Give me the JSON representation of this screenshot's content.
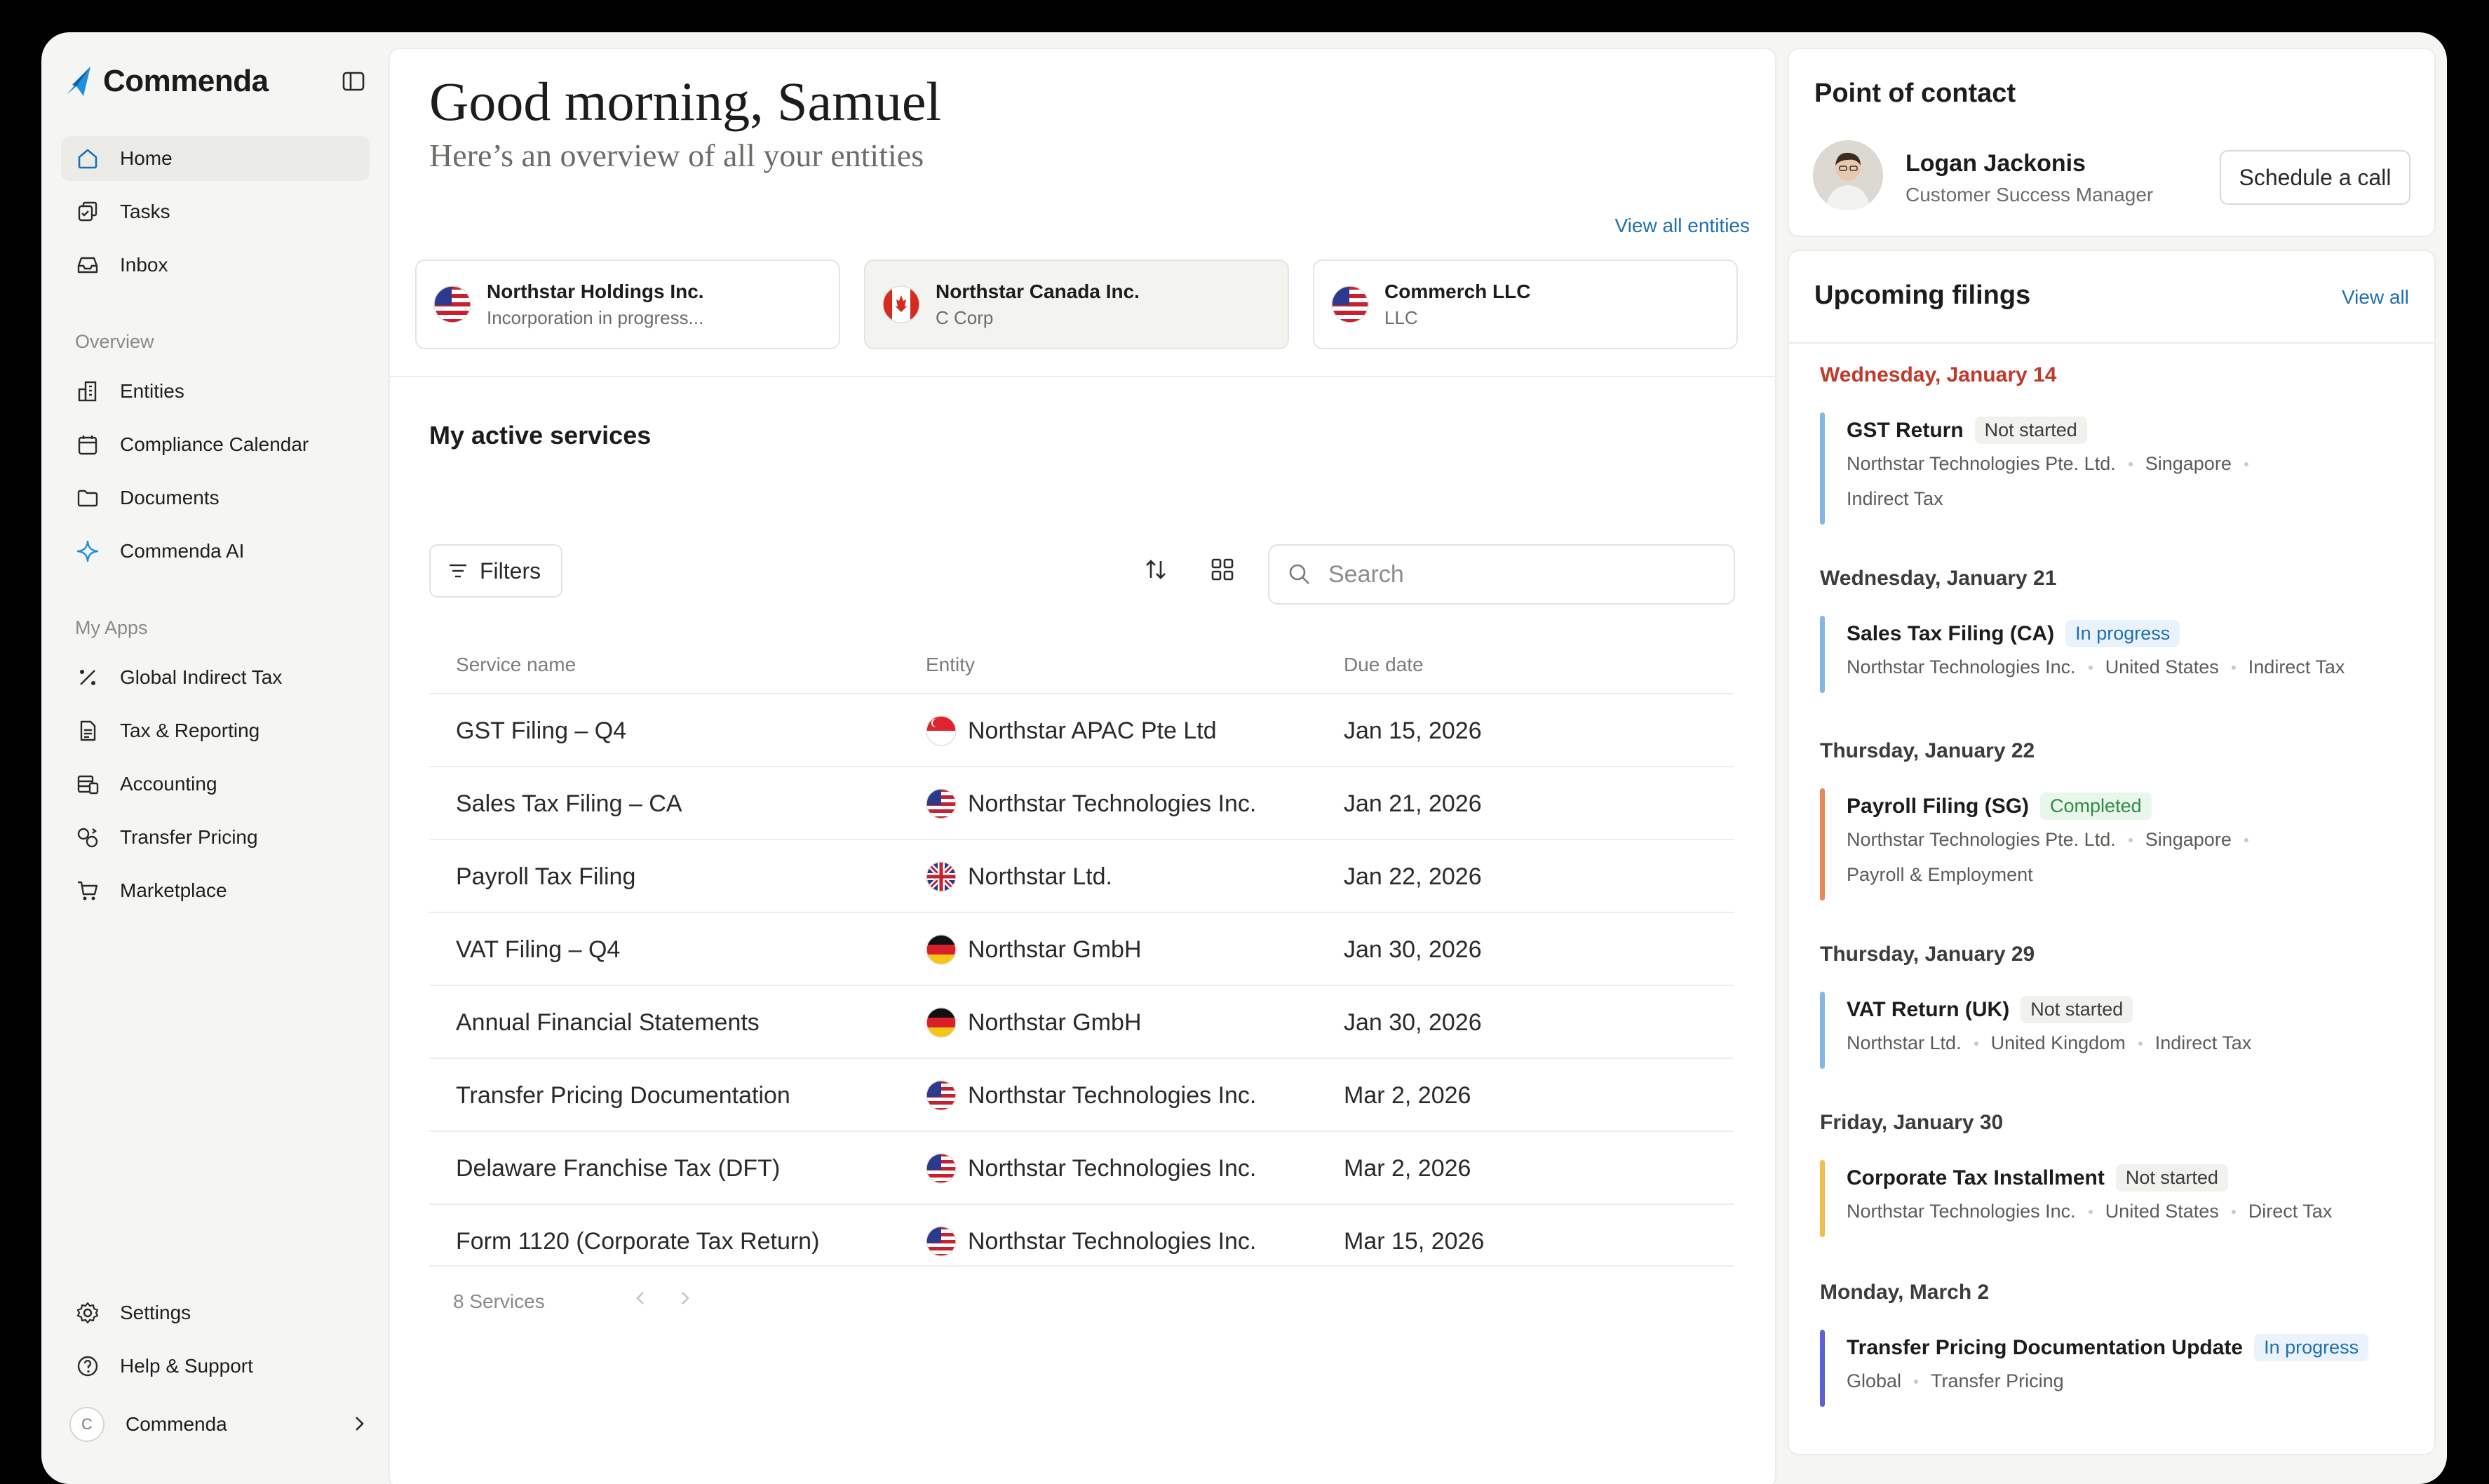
{
  "brand": {
    "name": "Commenda"
  },
  "sidebar": {
    "main_items": [
      {
        "label": "Home"
      },
      {
        "label": "Tasks"
      },
      {
        "label": "Inbox"
      }
    ],
    "overview_label": "Overview",
    "overview_items": [
      {
        "label": "Entities"
      },
      {
        "label": "Compliance Calendar"
      },
      {
        "label": "Documents"
      },
      {
        "label": "Commenda AI"
      }
    ],
    "apps_label": "My Apps",
    "app_items": [
      {
        "label": "Global Indirect Tax"
      },
      {
        "label": "Tax & Reporting"
      },
      {
        "label": "Accounting"
      },
      {
        "label": "Transfer Pricing"
      },
      {
        "label": "Marketplace"
      }
    ],
    "bottom_items": [
      {
        "label": "Settings"
      },
      {
        "label": "Help & Support"
      }
    ],
    "user": {
      "initial": "C",
      "name": "Commenda"
    }
  },
  "main": {
    "greeting": "Good morning, Samuel",
    "subtitle": "Here’s an overview of all your entities",
    "view_all_entities": "View all entities",
    "entities": [
      {
        "name": "Northstar Holdings Inc.",
        "sub": "Incorporation in progress...",
        "flag": "us"
      },
      {
        "name": "Northstar Canada Inc.",
        "sub": "C Corp",
        "flag": "ca"
      },
      {
        "name": "Commerch LLC",
        "sub": "LLC",
        "flag": "us"
      }
    ],
    "services_title": "My active services",
    "filters_label": "Filters",
    "search_placeholder": "Search",
    "columns": {
      "service": "Service name",
      "entity": "Entity",
      "due": "Due date"
    },
    "rows": [
      {
        "service": "GST Filing – Q4",
        "entity": "Northstar APAC Pte Ltd",
        "due": "Jan 15, 2026",
        "flag": "sg"
      },
      {
        "service": "Sales Tax Filing – CA",
        "entity": "Northstar Technologies Inc.",
        "due": "Jan 21, 2026",
        "flag": "us"
      },
      {
        "service": "Payroll Tax Filing",
        "entity": "Northstar Ltd.",
        "due": "Jan 22, 2026",
        "flag": "uk"
      },
      {
        "service": "VAT Filing – Q4",
        "entity": "Northstar GmbH",
        "due": "Jan 30, 2026",
        "flag": "de"
      },
      {
        "service": "Annual Financial Statements",
        "entity": "Northstar GmbH",
        "due": "Jan 30, 2026",
        "flag": "de"
      },
      {
        "service": "Transfer Pricing Documentation",
        "entity": "Northstar Technologies Inc.",
        "due": "Mar 2, 2026",
        "flag": "us"
      },
      {
        "service": "Delaware Franchise Tax (DFT)",
        "entity": "Northstar Technologies Inc.",
        "due": "Mar 2, 2026",
        "flag": "us"
      },
      {
        "service": "Form 1120 (Corporate Tax Return)",
        "entity": "Northstar Technologies Inc.",
        "due": "Mar 15, 2026",
        "flag": "us"
      }
    ],
    "count_label": "8 Services"
  },
  "contact": {
    "title": "Point of contact",
    "name": "Logan Jackonis",
    "role": "Customer Success Manager",
    "button": "Schedule a call"
  },
  "filings": {
    "title": "Upcoming filings",
    "view_all": "View all",
    "groups": [
      {
        "date": "Wednesday, January 14",
        "title": "GST Return",
        "status": "Not started",
        "meta1": [
          "Northstar Technologies Pte. Ltd.",
          "Singapore"
        ],
        "meta2": [
          "Indirect Tax"
        ],
        "color": "#86b6e6"
      },
      {
        "date": "Wednesday, January 21",
        "title": "Sales Tax Filing (CA)",
        "status": "In progress",
        "meta1": [
          "Northstar Technologies Inc.",
          "United States",
          "Indirect Tax"
        ],
        "meta2": [],
        "color": "#86b6e6"
      },
      {
        "date": "Thursday, January 22",
        "title": "Payroll Filing (SG)",
        "status": "Completed",
        "meta1": [
          "Northstar Technologies Pte. Ltd.",
          "Singapore"
        ],
        "meta2": [
          "Payroll & Employment"
        ],
        "color": "#e8895a"
      },
      {
        "date": "Thursday, January 29",
        "title": "VAT Return (UK)",
        "status": "Not started",
        "meta1": [
          "Northstar Ltd.",
          "United Kingdom",
          "Indirect Tax"
        ],
        "meta2": [],
        "color": "#86b6e6"
      },
      {
        "date": "Friday, January 30",
        "title": "Corporate Tax Installment",
        "status": "Not started",
        "meta1": [
          "Northstar Technologies Inc.",
          "United States",
          "Direct Tax"
        ],
        "meta2": [],
        "color": "#efbf4e"
      },
      {
        "date": "Monday, March 2",
        "title": "Transfer Pricing Documentation Update",
        "status": "In progress",
        "meta1": [
          "Global",
          "Transfer Pricing"
        ],
        "meta2": [],
        "color": "#5b62d9"
      }
    ]
  }
}
